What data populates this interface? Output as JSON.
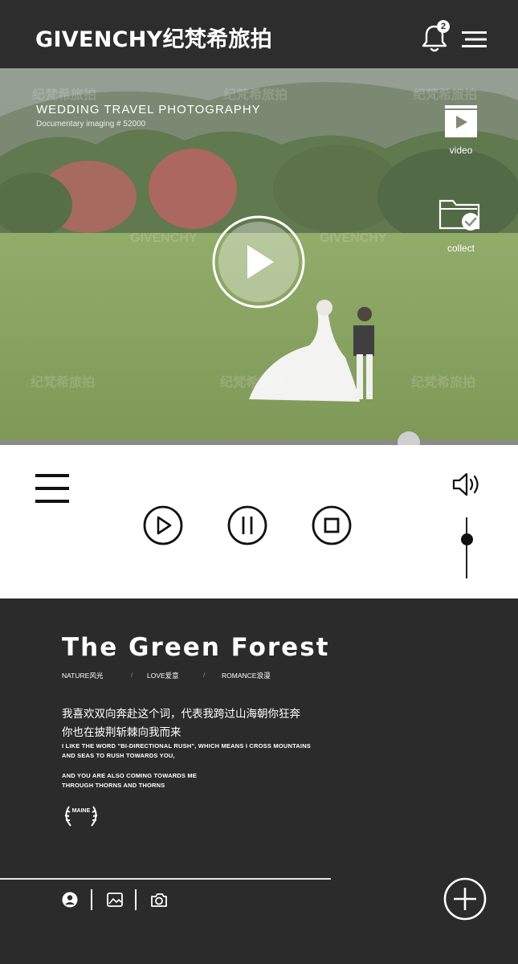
{
  "header": {
    "brand": "GIVENCHY纪梵希旅拍",
    "notification_count": "2",
    "icons": [
      "bell-icon",
      "menu-icon"
    ]
  },
  "hero": {
    "title": "WEDDING TRAVEL PHOTOGRAPHY",
    "subtitle": "Documentary imaging # 52000",
    "watermarks": [
      "纪梵希旅拍",
      "GIVENCHY"
    ],
    "video_label": "video",
    "collect_label": "collect"
  },
  "player": {
    "progress_fraction": 0.79,
    "volume_fraction": 0.65,
    "controls": [
      "play",
      "pause",
      "stop"
    ]
  },
  "article": {
    "title": "The Green Forest",
    "tags": [
      "NATURE风光",
      "LOVE爱意",
      "ROMANCE浪漫"
    ],
    "tag_separator": "/",
    "cn_lines": [
      "我喜欢双向奔赴这个词，代表我跨过山海朝你狂奔",
      "你也在披荆斩棘向我而来"
    ],
    "en_lines": [
      "I LIKE THE WORD \"BI-DIRECTIONAL RUSH\", WHICH MEANS I CROSS MOUNTAINS",
      "AND SEAS TO RUSH TOWARDS YOU,",
      "AND YOU ARE ALSO COMING TOWARDS ME",
      "THROUGH THORNS AND THORNS"
    ],
    "badge_text": "MAINE"
  },
  "bottom_nav": {
    "icons": [
      "user-icon",
      "gallery-icon",
      "camera-icon",
      "add-icon"
    ]
  },
  "colors": {
    "dark_bg": "#2b2b2b",
    "header_bg": "#2d2d2d",
    "controls_bg": "#ffffff",
    "grass": "#7c9a52"
  }
}
